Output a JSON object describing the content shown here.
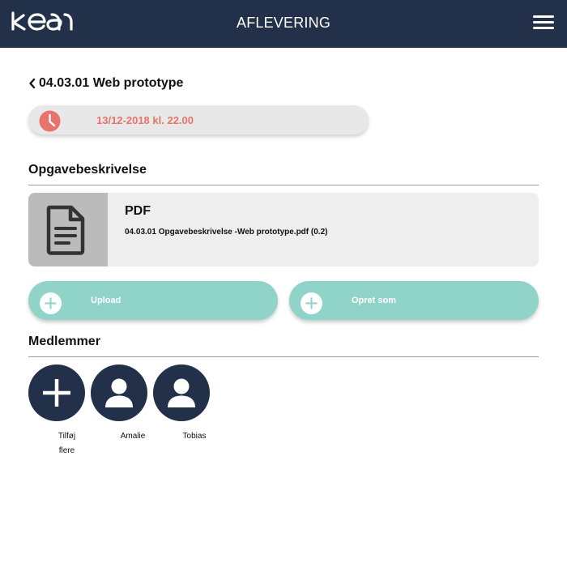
{
  "header": {
    "logo_text": "kea",
    "title": "AFLEVERING",
    "menu_icon": "hamburger-menu-icon"
  },
  "assignment": {
    "back_icon": "chevron-left-icon",
    "title": "04.03.01 Web prototype",
    "deadline_icon": "clock-icon",
    "deadline": "13/12-2018 kl. 22.00"
  },
  "description": {
    "section_title": "Opgavebeskrivelse",
    "file": {
      "icon": "document-icon",
      "type": "PDF",
      "name": "04.03.01 Opgavebeskrivelse -Web prototype.pdf (0.2)"
    }
  },
  "actions": {
    "upload_label": "Upload",
    "create_label": "Opret som",
    "plus_icon": "plus-circle-icon"
  },
  "members": {
    "section_title": "Medlemmer",
    "add_label_line1": "Tilføj",
    "add_label_line2": "flere",
    "people": [
      {
        "name": "Amalie",
        "icon": "user-avatar-icon"
      },
      {
        "name": "Tobias",
        "icon": "user-avatar-icon"
      }
    ]
  },
  "colors": {
    "header_bg": "#223049",
    "accent_teal": "#8fd3c9",
    "deadline_red": "#e8736b",
    "card_bg": "#eeeeee"
  }
}
